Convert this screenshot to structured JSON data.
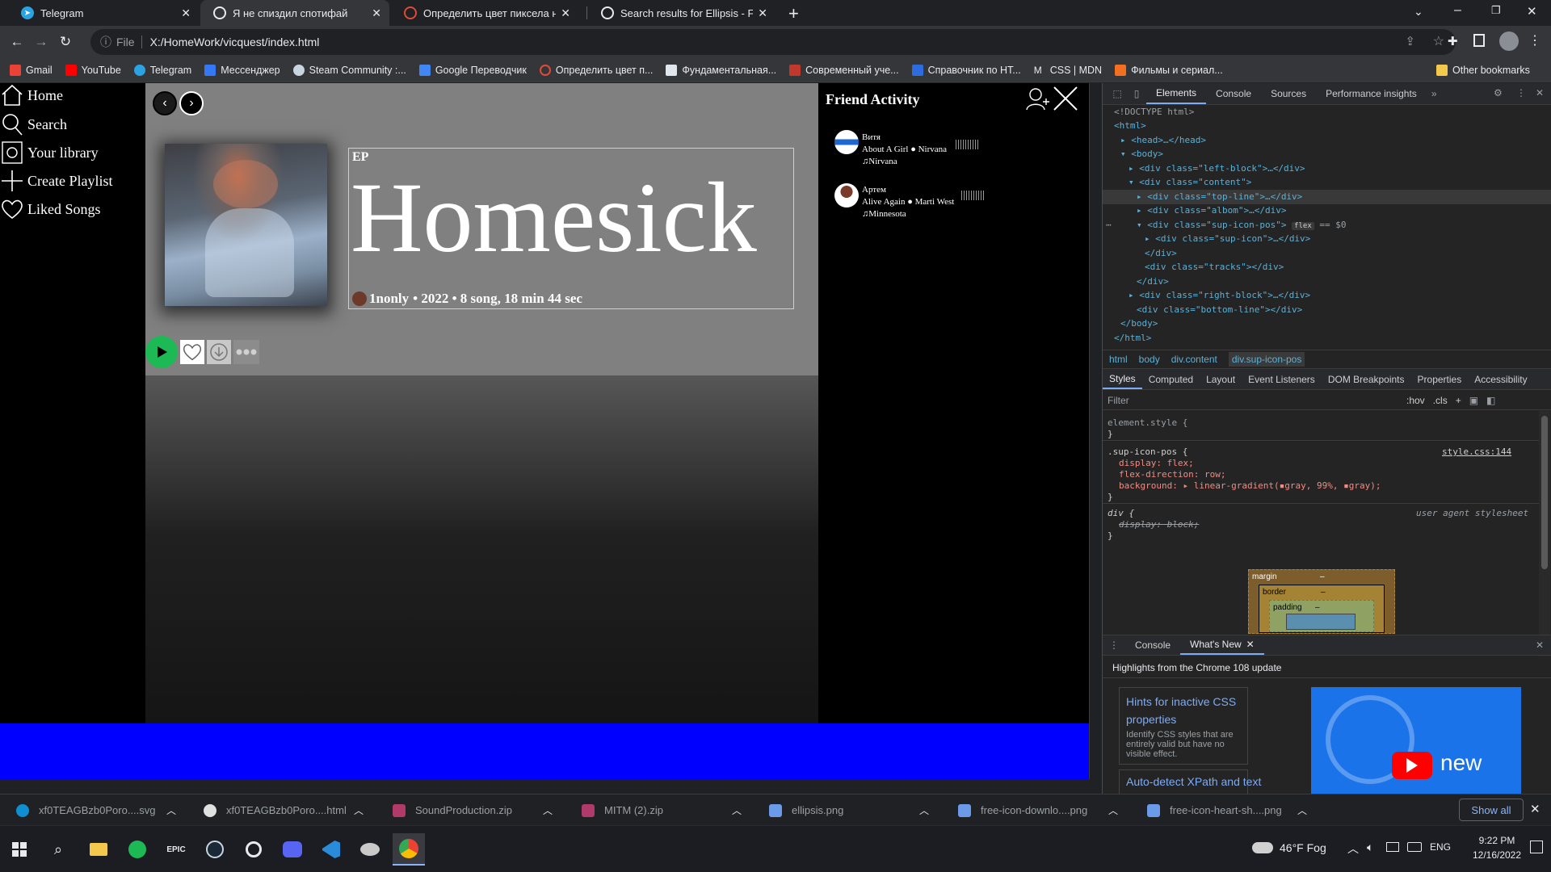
{
  "browser": {
    "tabs": [
      {
        "title": "Telegram",
        "active": false
      },
      {
        "title": "Я не спиздил спотифай",
        "active": true
      },
      {
        "title": "Определить цвет пиксела на ка",
        "active": false
      },
      {
        "title": "Search results for Ellipsis - Flatico",
        "active": false
      }
    ],
    "new_tab": "+",
    "address": {
      "security": "File",
      "url": "X:/HomeWork/vicquest/index.html"
    },
    "bookmarks": [
      "Gmail",
      "YouTube",
      "Telegram",
      "Мессенджер",
      "Steam Community :...",
      "Google Переводчик",
      "Определить цвет п...",
      "Фундаментальная...",
      "Современный уче...",
      "Справочник по HT...",
      "CSS | MDN",
      "Фильмы и сериал..."
    ],
    "other_bookmarks": "Other bookmarks"
  },
  "page": {
    "nav": [
      {
        "label": "Home",
        "icon": "home-icon"
      },
      {
        "label": "Search",
        "icon": "search-icon"
      },
      {
        "label": "Your library",
        "icon": "library-icon"
      },
      {
        "label": "Create Playlist",
        "icon": "plus-icon"
      },
      {
        "label": "Liked Songs",
        "icon": "heart-icon"
      }
    ],
    "album": {
      "type": "EP",
      "title": "Homesick",
      "artist": "1nonly",
      "meta": "• 2022 • 8 song, 18 min 44 sec"
    },
    "friend_activity": {
      "title": "Friend Activity",
      "friends": [
        {
          "name": "Витя",
          "track": "About A Girl ● Nirvana",
          "album": "Nirvana"
        },
        {
          "name": "Артем",
          "track": "Alive Again ● Marti West",
          "album": "Minnesota"
        }
      ]
    }
  },
  "devtools": {
    "tabs": [
      "Elements",
      "Console",
      "Sources",
      "Performance insights"
    ],
    "dom": [
      "<!DOCTYPE html>",
      "<html>",
      "<head>…</head>",
      "<body>",
      "<div class=\"left-block\">…</div>",
      "<div class=\"content\">",
      "<div class=\"top-line\">…</div>",
      "<div class=\"albom\">…</div>",
      "<div class=\"sup-icon-pos\">",
      "<div class=\"sup-icon\">…</div>",
      "</div>",
      "<div class=\"tracks\"></div>",
      "</div>",
      "<div class=\"right-block\">…</div>",
      "<div class=\"bottom-line\"></div>",
      "</body>",
      "</html>"
    ],
    "selected_badge": "flex",
    "selected_suffix": "== $0",
    "breadcrumbs": [
      "html",
      "body",
      "div.content",
      "div.sup-icon-pos"
    ],
    "style_tabs": [
      "Styles",
      "Computed",
      "Layout",
      "Event Listeners",
      "DOM Breakpoints",
      "Properties",
      "Accessibility"
    ],
    "filter_placeholder": "Filter",
    "filter_tools": [
      ":hov",
      ".cls",
      "+"
    ],
    "rules": {
      "element_style": "element.style {",
      "close": "}",
      "sup_selector": ".sup-icon-pos {",
      "sup_source": "style.css:144",
      "decl1": "display: flex;",
      "decl2": "flex-direction: row;",
      "decl3": "background: ▸ linear-gradient(▪gray, 99%, ▪gray);",
      "div_selector": "div {",
      "div_source": "user agent stylesheet",
      "div_decl": "display: block;"
    },
    "box_model": {
      "margin": "margin",
      "border": "border",
      "padding": "padding",
      "dash": "–"
    },
    "drawer_tabs": [
      "Console",
      "What's New"
    ],
    "whats_new_heading": "Highlights from the Chrome 108 update",
    "cards": [
      {
        "title": "Hints for inactive CSS properties",
        "desc": "Identify CSS styles that are entirely valid but have no visible effect."
      },
      {
        "title": "Auto-detect XPath and text",
        "desc": ""
      }
    ],
    "video_text": "new"
  },
  "downloads": {
    "items": [
      "xf0TEAGBzb0Poro....svg",
      "xf0TEAGBzb0Poro....html",
      "SoundProduction.zip",
      "MITM (2).zip",
      "ellipsis.png",
      "free-icon-downlo....png",
      "free-icon-heart-sh....png"
    ],
    "show_all": "Show all"
  },
  "taskbar": {
    "weather": "46°F  Fog",
    "lang": "ENG",
    "time": "9:22 PM",
    "date": "12/16/2022"
  }
}
